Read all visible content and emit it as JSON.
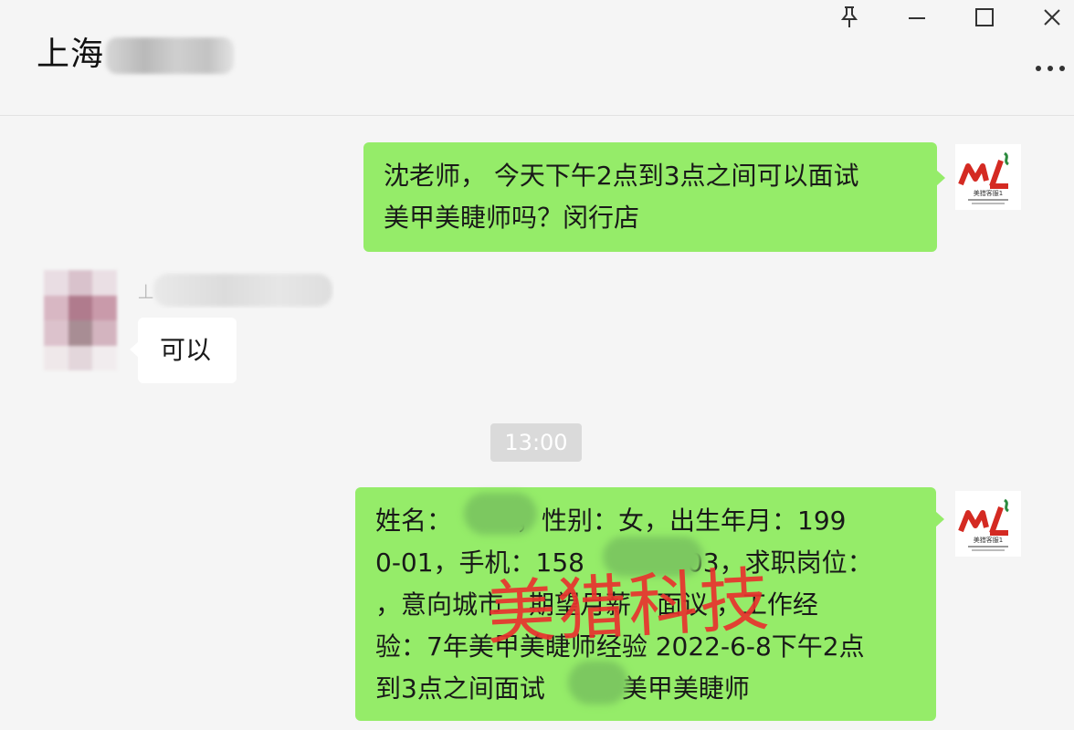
{
  "window": {
    "title": "上海",
    "controls": {
      "pin": "pin-icon",
      "minimize": "minimize-icon",
      "maximize": "maximize-icon",
      "close": "close-icon",
      "more": "more-icon"
    }
  },
  "messages": [
    {
      "from": "me",
      "lines": [
        "沈老师， 今天下午2点到3点之间可以面试",
        "美甲美睫师吗？闵行店"
      ]
    },
    {
      "from": "other",
      "text": "可以"
    },
    {
      "from": "me",
      "lines": [
        "姓名：　　　，性别：女，出生年月：199",
        "0-01，手机：158　　　　03，求职岗位：",
        "，意向城市　期望月薪　面议 ，工作经",
        "验：7年美甲美睫师经验 2022-6-8下午2点",
        "到3点之间面试　　　美甲美睫师"
      ]
    }
  ],
  "timestamp": "13:00",
  "avatar": {
    "logo_text": "ML",
    "caption": "美猎客服1"
  },
  "watermark": "美猎科技",
  "colors": {
    "my_bubble": "#95ec69",
    "other_bubble": "#ffffff",
    "background": "#f5f5f5",
    "watermark": "#e8332e"
  }
}
